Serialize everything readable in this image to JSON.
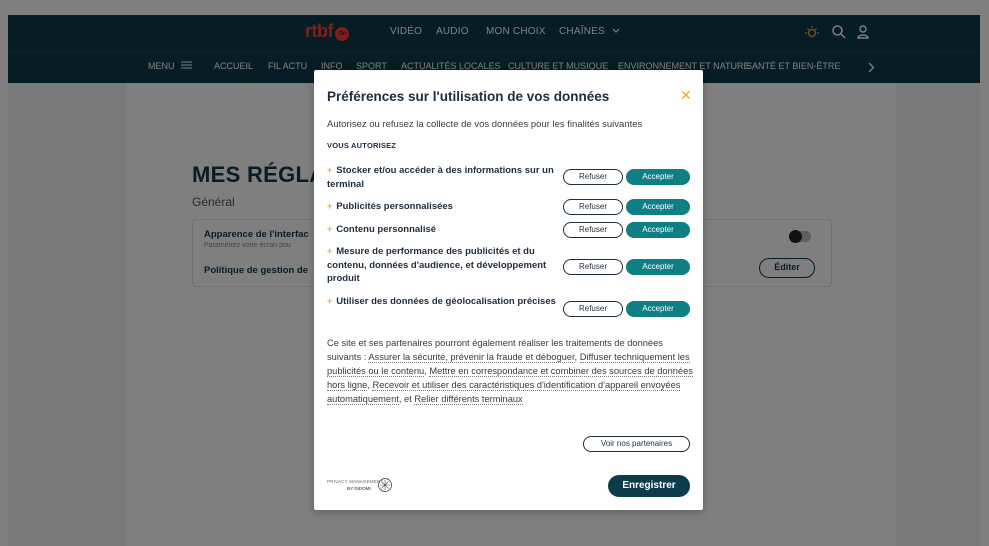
{
  "header": {
    "logo_text": "rtbf",
    "logo_badge": "On",
    "top_links": [
      "VIDÉO",
      "AUDIO",
      "MON CHOIX",
      "CHAÎNES"
    ],
    "menu_label": "MENU",
    "nav_items": [
      "ACCUEIL",
      "FIL ACTU",
      "INFO",
      "SPORT",
      "ACTUALITÉS LOCALES",
      "CULTURE ET MUSIQUE",
      "ENVIRONNEMENT ET NATURE",
      "SANTÉ ET BIEN-ÊTRE"
    ],
    "icons": [
      "weather-icon",
      "search-icon",
      "user-icon",
      "chevron-down-icon",
      "chevron-right-icon",
      "hamburger-icon"
    ]
  },
  "settings": {
    "title": "MES RÉGLA",
    "section": "Général",
    "card_title_1": "Apparence de l'interfac",
    "card_sub_1": "Paramétrez votre écran pou",
    "card_title_2": "Politique de gestion de",
    "edit_label": "Éditer"
  },
  "modal": {
    "title": "Préférences sur l'utilisation de vos données",
    "close_icon": "close-icon",
    "intro": "Autorisez ou refusez la collecte de vos données pour les finalités suivantes",
    "allow_heading": "VOUS AUTORISEZ",
    "purposes": [
      {
        "label": "Stocker et/ou accéder à des informations sur un terminal",
        "refuse": "Refuser",
        "accept": "Accepter"
      },
      {
        "label": "Publicités personnalisées",
        "refuse": "Refuser",
        "accept": "Accepter"
      },
      {
        "label": "Contenu personnalisé",
        "refuse": "Refuser",
        "accept": "Accepter"
      },
      {
        "label": "Mesure de performance des publicités et du contenu, données d'audience, et développement produit",
        "refuse": "Refuser",
        "accept": "Accepter"
      },
      {
        "label": "Utiliser des données de géolocalisation précises",
        "refuse": "Refuser",
        "accept": "Accepter"
      }
    ],
    "legal": {
      "intro": "Ce site et ses partenaires pourront également réaliser les traitements de données suivants : ",
      "link1": "Assurer la sécurité, prévenir la fraude et déboguer",
      "sep1": ", ",
      "link2": "Diffuser techniquement les publicités ou le contenu",
      "sep2": ", ",
      "link3": "Mettre en correspondance et combiner des sources de données hors ligne",
      "sep3": ", ",
      "link4": "Recevoir et utiliser des caractéristiques d'identification d'appareil envoyées automatiquement",
      "sep4": ", et ",
      "link5": "Relier différents terminaux"
    },
    "partners_label": "Voir nos partenaires",
    "didomi_line1": "PRIVACY MANAGEMENT",
    "didomi_line2": "BY DIDOMI",
    "save_label": "Enregistrer"
  },
  "colors": {
    "header_bg": "#0d3b4c",
    "accent_orange": "#f5a623",
    "accept_teal": "#0e7f84",
    "brand_red": "#ff3e35"
  }
}
